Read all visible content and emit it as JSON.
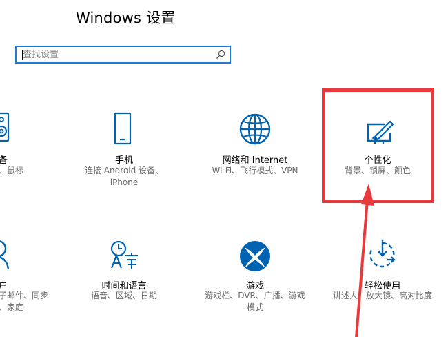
{
  "window": {
    "title": "Windows 设置"
  },
  "search": {
    "placeholder": "查找设置",
    "icon": "search-icon"
  },
  "tiles": [
    {
      "id": "devices",
      "title": "备",
      "desc_lines": [
        "、鼠标"
      ],
      "icon": "speaker-keyboard-icon",
      "partial": true
    },
    {
      "id": "phone",
      "title": "手机",
      "desc_lines": [
        "连接 Android 设备、",
        "iPhone"
      ],
      "icon": "phone-icon"
    },
    {
      "id": "network",
      "title": "网络和 Internet",
      "desc_lines": [
        "Wi-Fi、飞行模式、VPN"
      ],
      "icon": "globe-icon"
    },
    {
      "id": "personalization",
      "title": "个性化",
      "desc_lines": [
        "背景、锁屏、颜色"
      ],
      "icon": "paint-brush-screen-icon",
      "highlighted": true
    },
    {
      "id": "accounts",
      "title": "户",
      "desc_lines": [
        "子邮件、同步",
        "、家庭"
      ],
      "icon": "person-icon",
      "partial": true
    },
    {
      "id": "time-language",
      "title": "时间和语言",
      "desc_lines": [
        "语音、区域、日期"
      ],
      "icon": "clock-language-icon"
    },
    {
      "id": "gaming",
      "title": "游戏",
      "desc_lines": [
        "游戏栏、DVR、广播、游戏",
        "模式"
      ],
      "icon": "xbox-icon"
    },
    {
      "id": "ease-of-access",
      "title": "轻松使用",
      "desc_lines": [
        "讲述人、放大镜、高对比度"
      ],
      "icon": "ease-of-access-timer-icon"
    }
  ],
  "colors": {
    "accent": "#0063b1",
    "search_border": "#1f7ad1",
    "annotation": "#e8393b",
    "desc_text": "#6b6b6b"
  }
}
